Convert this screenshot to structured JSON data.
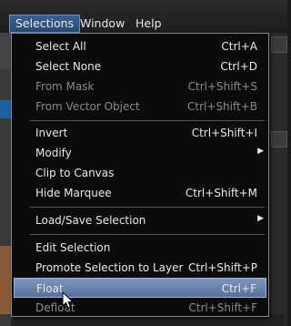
{
  "menubar": {
    "items": [
      {
        "label": "Selections",
        "active": true
      },
      {
        "label": "Window",
        "active": false
      },
      {
        "label": "Help",
        "active": false
      }
    ]
  },
  "menu": {
    "items": [
      {
        "label": "Select All",
        "shortcut": "Ctrl+A",
        "enabled": true
      },
      {
        "label": "Select None",
        "shortcut": "Ctrl+D",
        "enabled": true
      },
      {
        "label": "From Mask",
        "shortcut": "Ctrl+Shift+S",
        "enabled": false
      },
      {
        "label": "From Vector Object",
        "shortcut": "Ctrl+Shift+B",
        "enabled": false
      },
      {
        "label": "Invert",
        "shortcut": "Ctrl+Shift+I",
        "enabled": true
      },
      {
        "label": "Modify",
        "shortcut": "",
        "enabled": true,
        "submenu": true
      },
      {
        "label": "Clip to Canvas",
        "shortcut": "",
        "enabled": true
      },
      {
        "label": "Hide Marquee",
        "shortcut": "Ctrl+Shift+M",
        "enabled": true
      },
      {
        "label": "Load/Save Selection",
        "shortcut": "",
        "enabled": true,
        "submenu": true
      },
      {
        "label": "Edit Selection",
        "shortcut": "",
        "enabled": true
      },
      {
        "label": "Promote Selection to Layer",
        "shortcut": "Ctrl+Shift+P",
        "enabled": true
      },
      {
        "label": "Float",
        "shortcut": "Ctrl+F",
        "enabled": true,
        "highlighted": true
      },
      {
        "label": "Defloat",
        "shortcut": "Ctrl+Shift+F",
        "enabled": false
      }
    ],
    "submenu_arrow": "▶"
  },
  "colors": {
    "highlight": "#6a84ad",
    "menu_bg": "#0b0b0b",
    "disabled_text": "#8a8a8a"
  }
}
